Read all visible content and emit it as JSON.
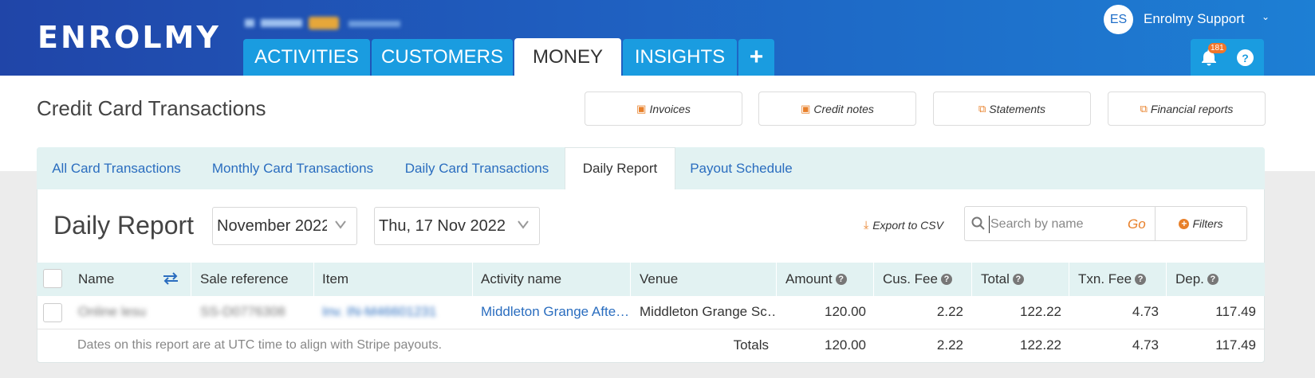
{
  "brand": {
    "logo_text": "ENROLMY"
  },
  "nav": {
    "tabs": [
      "ACTIVITIES",
      "CUSTOMERS",
      "MONEY",
      "INSIGHTS"
    ],
    "active": "MONEY",
    "add_label": "+"
  },
  "user": {
    "initials": "ES",
    "name": "Enrolmy Support",
    "notification_count": "181",
    "help_label": "?"
  },
  "page": {
    "title": "Credit Card Transactions",
    "actions": [
      "Invoices",
      "Credit notes",
      "Statements",
      "Financial reports"
    ]
  },
  "subtabs": {
    "items": [
      "All Card Transactions",
      "Monthly Card Transactions",
      "Daily Card Transactions",
      "Daily Report",
      "Payout Schedule"
    ],
    "active": "Daily Report"
  },
  "report": {
    "title": "Daily Report",
    "month_select": "November 2022",
    "day_select": "Thu, 17 Nov 2022",
    "export_label": "Export to CSV",
    "search_placeholder": "Search by name",
    "go_label": "Go",
    "filters_label": "Filters"
  },
  "table": {
    "columns": [
      "Name",
      "Sale reference",
      "Item",
      "Activity name",
      "Venue",
      "Amount",
      "Cus. Fee",
      "Total",
      "Txn. Fee",
      "Dep."
    ],
    "rows": [
      {
        "name": "Online ​lesu",
        "sale_reference": "SS-D0776308",
        "item": "Inv. IN-M46601231",
        "activity_name": "Middleton Grange Afte…",
        "venue": "Middleton Grange Sc…",
        "amount": "120.00",
        "cus_fee": "2.22",
        "total": "122.22",
        "txn_fee": "4.73",
        "dep": "117.49"
      }
    ],
    "footer_note": "Dates on this report are at UTC time to align with Stripe payouts.",
    "totals_label": "Totals",
    "totals": {
      "amount": "120.00",
      "cus_fee": "2.22",
      "total": "122.22",
      "txn_fee": "4.73",
      "dep": "117.49"
    }
  },
  "colors": {
    "header_start": "#2045a8",
    "header_end": "#1d7fd4",
    "tab_blue": "#1a9ce0",
    "accent_orange": "#e8802a",
    "link_blue": "#2a6dbf",
    "table_head_bg": "#e2f2f2"
  }
}
